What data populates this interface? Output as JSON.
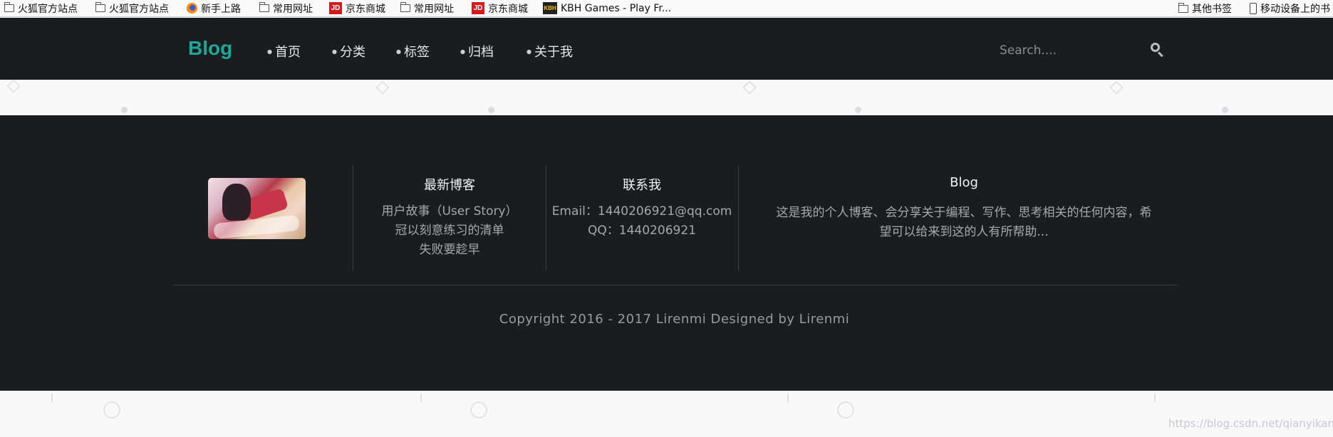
{
  "bookmarks": {
    "items": [
      {
        "label": "火狐官方站点",
        "icon": "folder-icon"
      },
      {
        "label": "火狐官方站点",
        "icon": "folder-icon"
      },
      {
        "label": "新手上路",
        "icon": "firefox-icon"
      },
      {
        "label": "常用网址",
        "icon": "folder-icon"
      },
      {
        "label": "京东商城",
        "icon": "jd-icon",
        "icon_text": "JD"
      },
      {
        "label": "常用网址",
        "icon": "folder-icon"
      },
      {
        "label": "京东商城",
        "icon": "jd-icon",
        "icon_text": "JD"
      },
      {
        "label": "KBH Games - Play Fr...",
        "icon": "kbh-icon",
        "icon_text": "KBH"
      }
    ],
    "other_label": "其他书签",
    "mobile_label": "移动设备上的书"
  },
  "nav": {
    "logo": "Blog",
    "items": [
      "首页",
      "分类",
      "标签",
      "归档",
      "关于我"
    ],
    "search_placeholder": "Search....",
    "accent_color": "#1fa89a"
  },
  "footer": {
    "latest": {
      "title": "最新博客",
      "links": [
        "用户故事（User Story）",
        "冠以刻意练习的清单",
        "失败要趁早"
      ]
    },
    "contact": {
      "title": "联系我",
      "email": "Email：1440206921@qq.com",
      "qq": "QQ：1440206921"
    },
    "about": {
      "title": "Blog",
      "text_line1": "这是我的个人博客、会分享关于编程、写作、思考相关的任何内容，希",
      "text_line2": "望可以给来到这的人有所帮助..."
    },
    "copyright": "Copyright 2016 - 2017 Lirenmi Designed by Lirenmi"
  },
  "watermark": "https://blog.csdn.net/qianyikang"
}
